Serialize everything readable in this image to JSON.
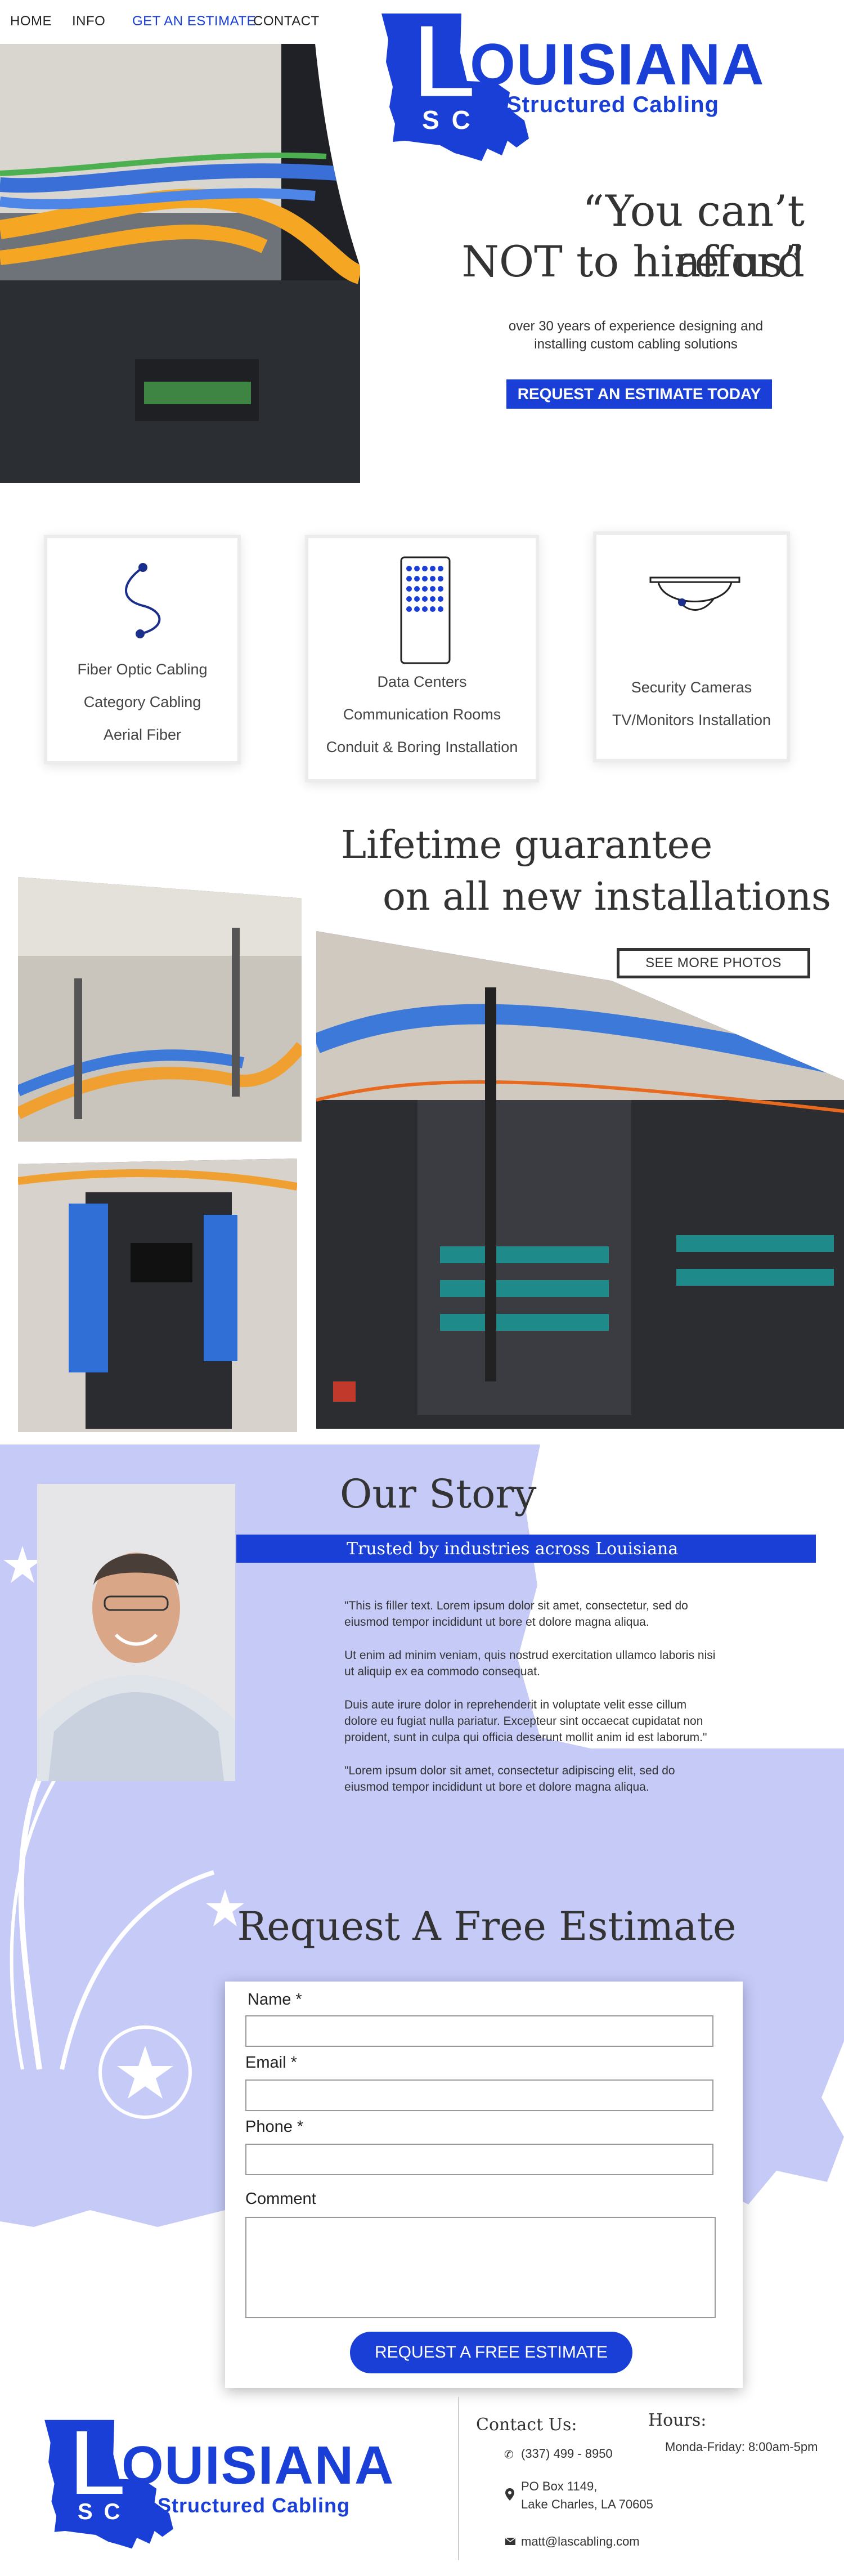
{
  "nav": {
    "items": [
      {
        "label": "HOME"
      },
      {
        "label": "INFO"
      },
      {
        "label": "GET AN ESTIMATE"
      },
      {
        "label": "CONTACT"
      }
    ]
  },
  "logo": {
    "wordmark": "OUISIANA",
    "initial": "L",
    "monogram": "SC",
    "tagline": "Structured Cabling",
    "brand_color": "#1a3fd6"
  },
  "hero": {
    "quote_line1": "“You can’t afford",
    "quote_line2": "NOT to hire us”",
    "subtitle_line1": "over 30 years of experience designing and",
    "subtitle_line2": "installing custom cabling solutions",
    "cta": "REQUEST AN ESTIMATE TODAY"
  },
  "services": [
    {
      "icon": "fiber-cable-icon",
      "lines": [
        "Fiber Optic Cabling",
        "Category Cabling",
        "Aerial Fiber"
      ]
    },
    {
      "icon": "server-rack-icon",
      "lines": [
        "Data Centers",
        "Communication Rooms",
        "Conduit & Boring Installation"
      ]
    },
    {
      "icon": "security-camera-icon",
      "lines": [
        "Security Cameras",
        "TV/Monitors Installation"
      ]
    }
  ],
  "gallery": {
    "heading_line1": "Lifetime guarantee",
    "heading_line2": "on all new installations",
    "more_button": "SEE MORE PHOTOS"
  },
  "story": {
    "title": "Our Story",
    "banner": "Trusted by industries across Louisiana",
    "paragraphs": [
      "\"This is filler text. Lorem ipsum dolor sit amet, consectetur, sed do eiusmod tempor incididunt ut bore et dolore magna aliqua.",
      "Ut enim ad minim veniam, quis nostrud exercitation ullamco laboris nisi ut aliquip ex ea commodo consequat.",
      "Duis aute irure dolor in reprehenderit  in voluptate velit esse cillum dolore eu fugiat nulla pariatur. Excepteur sint occaecat cupidatat non proident, sunt in culpa qui officia deserunt mollit anim id est laborum.\"",
      "\"Lorem ipsum dolor sit amet, consectetur adipiscing elit, sed do eiusmod tempor incididunt ut bore et dolore magna aliqua."
    ],
    "map_color": "#c5caf7"
  },
  "estimate": {
    "title": "Request A Free Estimate",
    "fields": {
      "name": "Name *",
      "email": "Email *",
      "phone": "Phone *",
      "comment": "Comment"
    },
    "values": {
      "name": "",
      "email": "",
      "phone": "",
      "comment": ""
    },
    "submit": "REQUEST A FREE ESTIMATE"
  },
  "footer": {
    "contact_title": "Contact Us:",
    "phone": "(337) 499 - 8950",
    "address_line1": "PO Box 1149,",
    "address_line2": "Lake Charles, LA 70605",
    "email": "matt@lascabling.com",
    "hours_title": "Hours:",
    "hours": "Monda-Friday: 8:00am-5pm"
  }
}
